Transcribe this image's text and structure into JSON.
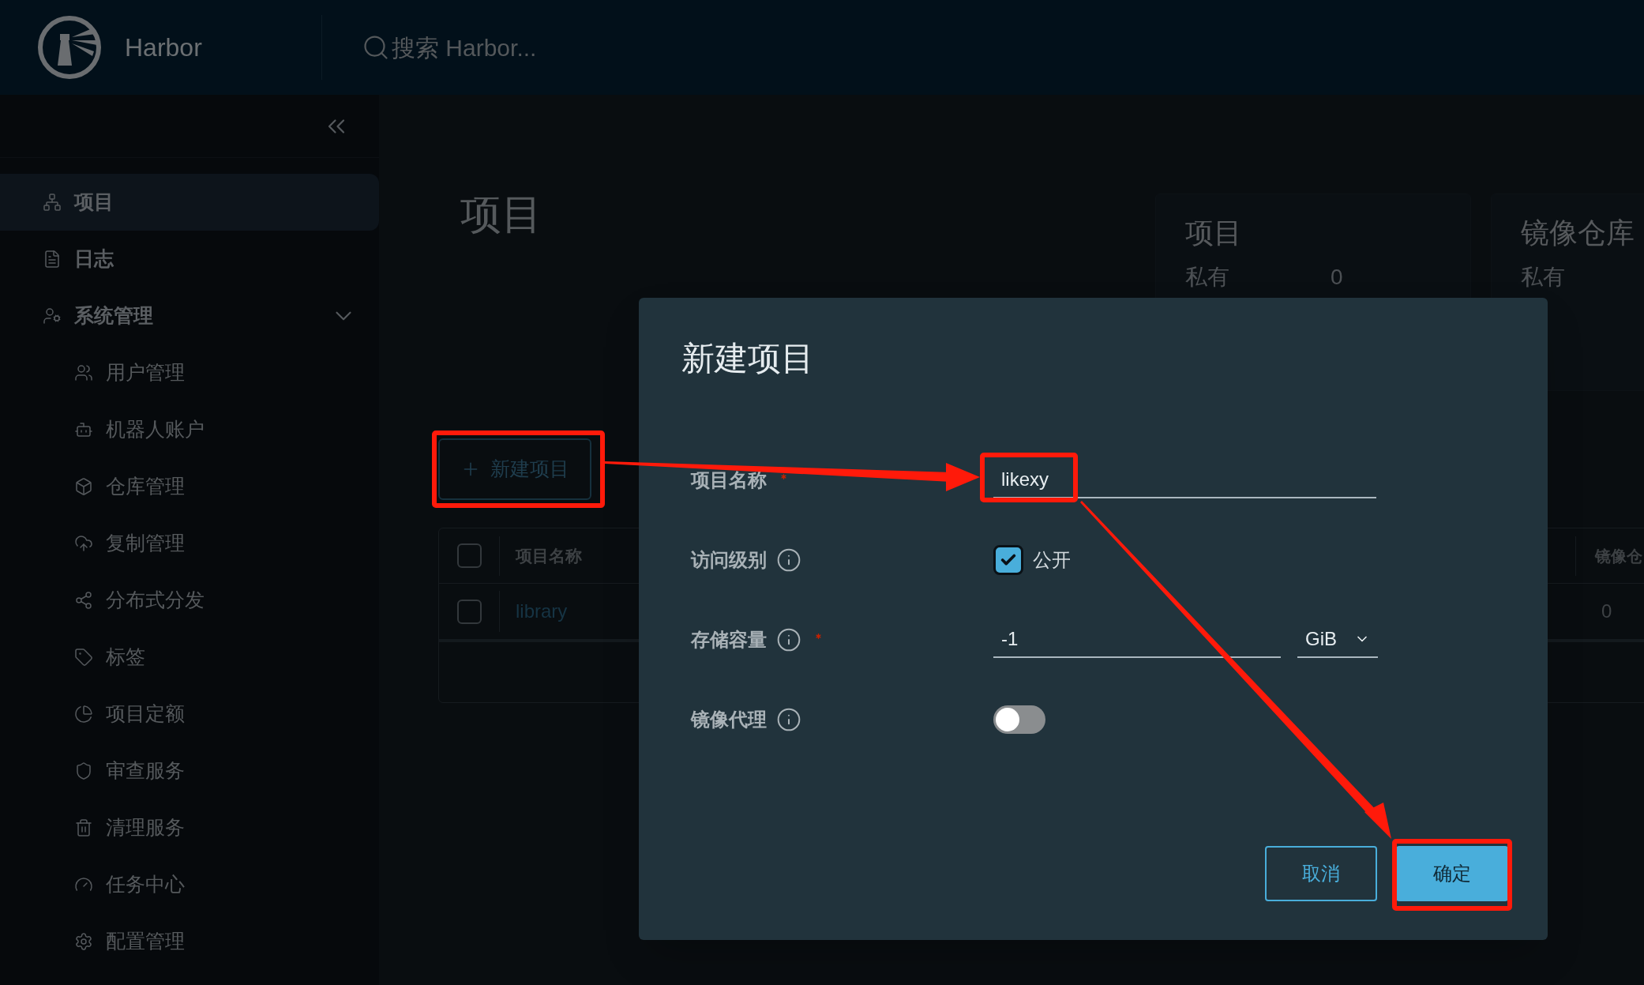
{
  "header": {
    "brand": "Harbor",
    "search": {
      "placeholder": "搜索 Harbor..."
    }
  },
  "sidebar": {
    "items": [
      {
        "label": "项目",
        "selected": true
      },
      {
        "label": "日志",
        "selected": false
      },
      {
        "label": "系统管理",
        "selected": false,
        "expanded": true,
        "children": [
          {
            "label": "用户管理",
            "selected": false
          },
          {
            "label": "机器人账户",
            "selected": false
          },
          {
            "label": "仓库管理",
            "selected": false
          },
          {
            "label": "复制管理",
            "selected": false
          },
          {
            "label": "分布式分发",
            "selected": false
          },
          {
            "label": "标签",
            "selected": false
          },
          {
            "label": "项目定额",
            "selected": false
          },
          {
            "label": "审查服务",
            "selected": false
          },
          {
            "label": "清理服务",
            "selected": false
          },
          {
            "label": "任务中心",
            "selected": false
          },
          {
            "label": "配置管理",
            "selected": false
          }
        ]
      }
    ]
  },
  "main": {
    "title": "项目",
    "cards": [
      {
        "title": "项目",
        "rows": [
          {
            "label": "私有",
            "value": "0"
          }
        ]
      },
      {
        "title": "镜像仓库",
        "rows": [
          {
            "label": "私有"
          }
        ]
      }
    ],
    "new_button": "新建项目",
    "table": {
      "select_all": {
        "checked": false
      },
      "columns": [
        "项目名称",
        "镜像仓"
      ],
      "rows": [
        {
          "checked": false,
          "cells": [
            "library",
            "0"
          ]
        }
      ]
    }
  },
  "dialog": {
    "title": "新建项目",
    "fields": [
      {
        "kind": "text",
        "label": "项目名称",
        "required": true,
        "info": false,
        "value": "likexy"
      },
      {
        "kind": "checkbox",
        "label": "访问级别",
        "required": false,
        "info": true,
        "option": "公开",
        "checked": true
      },
      {
        "kind": "quota",
        "label": "存储容量",
        "required": true,
        "info": true,
        "value": "-1",
        "unit": "GiB"
      },
      {
        "kind": "toggle",
        "label": "镜像代理",
        "required": false,
        "info": true,
        "on": false
      }
    ],
    "buttons": [
      {
        "label": "取消",
        "kind": "secondary"
      },
      {
        "label": "确定",
        "kind": "primary"
      }
    ]
  }
}
